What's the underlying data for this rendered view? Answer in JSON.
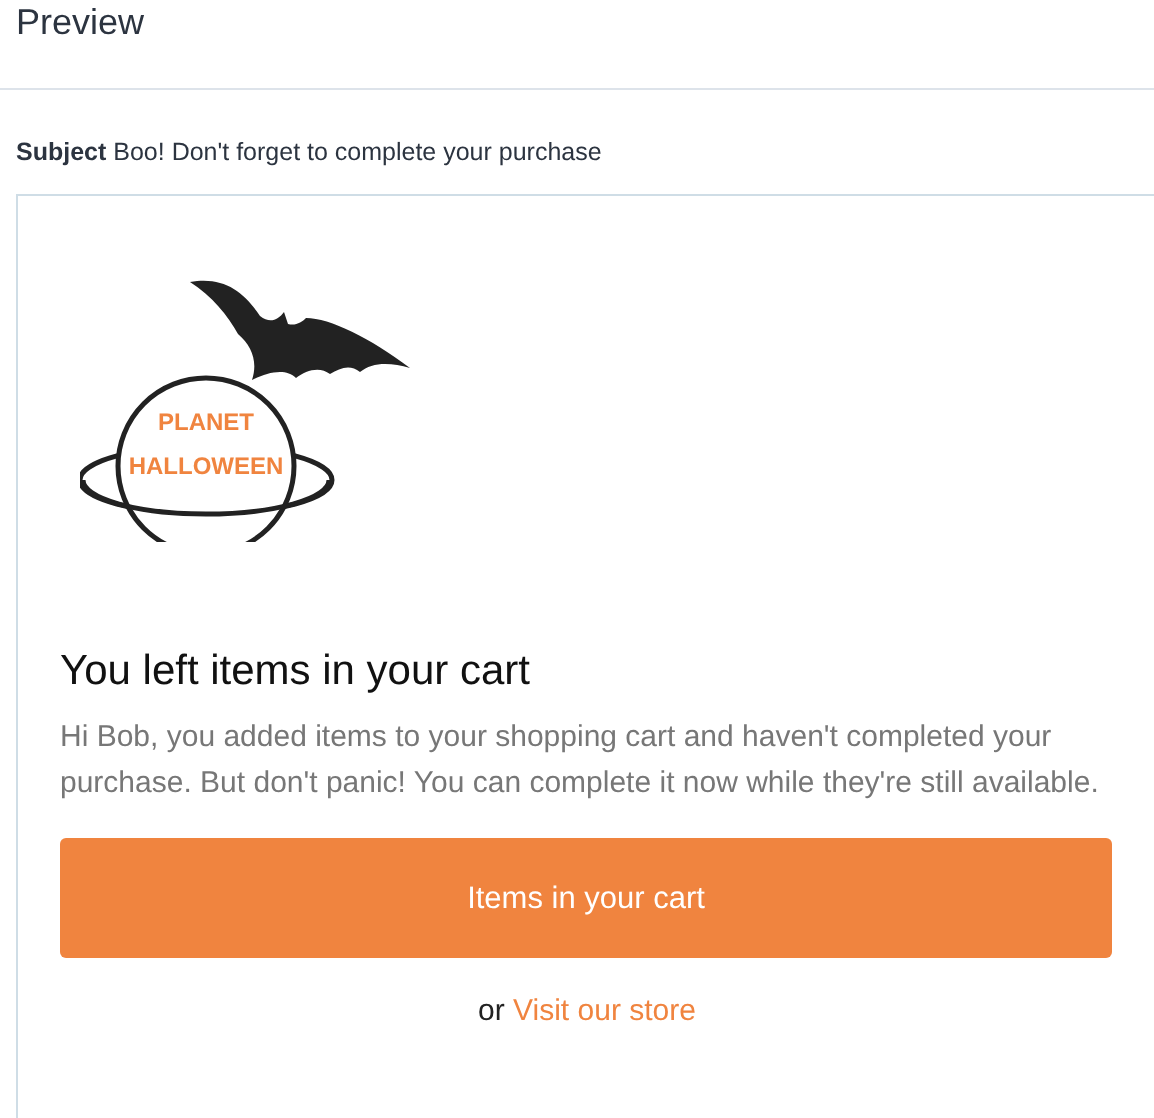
{
  "header": {
    "title": "Preview"
  },
  "subject": {
    "label": "Subject",
    "text": "Boo! Don't forget to complete your purchase"
  },
  "email": {
    "logo": {
      "line_1": "PLANET",
      "line_2": "HALLOWEEN"
    },
    "heading": "You left items in your cart",
    "body": "Hi Bob, you added items to your shopping cart and haven't completed your purchase. But don't panic! You can complete it now while they're still available.",
    "button": "Items in your cart",
    "footer": {
      "prefix": "or",
      "link": "Visit our store"
    }
  }
}
